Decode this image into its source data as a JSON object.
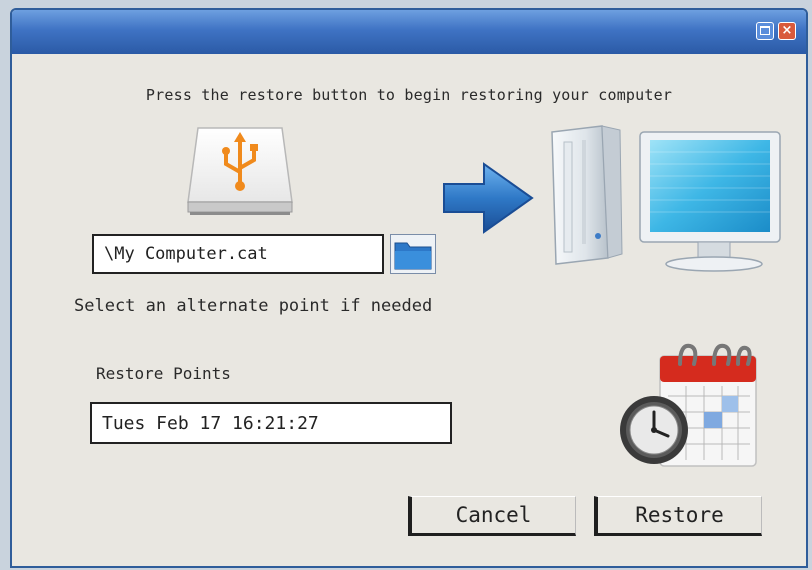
{
  "window": {
    "title": "",
    "controls": [
      "maximize",
      "close"
    ]
  },
  "instruction": "Press the restore button to begin restoring your computer",
  "source_file": {
    "value": "\\My Computer.cat",
    "browse_icon": "folder-icon"
  },
  "alternate_hint": "Select an alternate point if needed",
  "restore_points": {
    "label": "Restore Points",
    "selected": "Tues Feb 17 16:21:27"
  },
  "buttons": {
    "cancel": "Cancel",
    "restore": "Restore"
  },
  "icons": [
    "usb-drive-icon",
    "arrow-right-icon",
    "computer-icon",
    "calendar-clock-icon"
  ],
  "colors": {
    "titlebar": "#3f73c4",
    "dialog_background": "#e9e7e1",
    "close_button": "#d95a3c",
    "arrow": "#2f79c7"
  }
}
